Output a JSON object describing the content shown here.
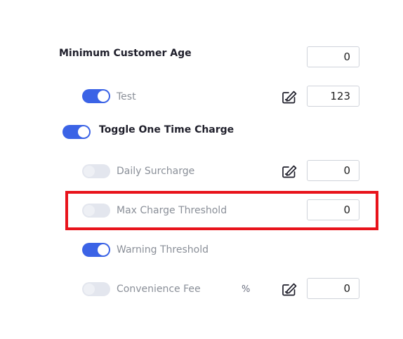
{
  "settings": {
    "min_age": {
      "label": "Minimum Customer Age",
      "value": "0"
    },
    "test": {
      "label": "Test",
      "enabled": true,
      "value": "123"
    },
    "one_time_charge": {
      "label": "Toggle One Time Charge",
      "enabled": true
    },
    "daily_surcharge": {
      "label": "Daily Surcharge",
      "enabled": false,
      "value": "0"
    },
    "max_charge_threshold": {
      "label": "Max Charge Threshold",
      "enabled": false,
      "value": "0"
    },
    "warning_threshold": {
      "label": "Warning Threshold",
      "enabled": true
    },
    "convenience_fee": {
      "label": "Convenience Fee",
      "enabled": false,
      "unit": "%",
      "value": "0"
    }
  },
  "icons": {
    "edit": "edit-pencil-icon"
  },
  "colors": {
    "toggle_on": "#3b63e6",
    "toggle_off": "#e3e6ee",
    "highlight_border": "#e8131b"
  }
}
